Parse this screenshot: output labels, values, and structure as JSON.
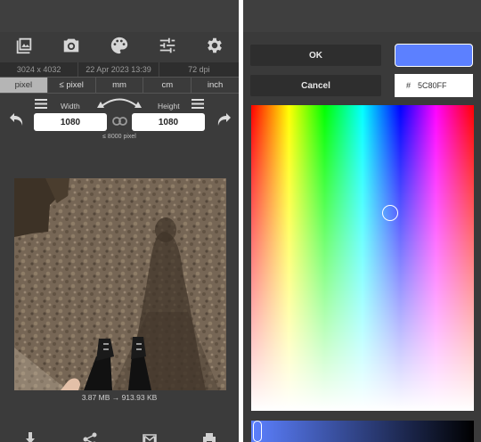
{
  "left": {
    "toolbar": {
      "icons": [
        "gallery-icon",
        "camera-icon",
        "palette-icon",
        "sliders-icon",
        "gear-icon"
      ]
    },
    "info": {
      "dimensions": "3024 x 4032",
      "date": "22 Apr 2023 13:39",
      "dpi": "72 dpi"
    },
    "units": {
      "items": [
        "pixel",
        "≤ pixel",
        "mm",
        "cm",
        "inch"
      ],
      "selected": "pixel"
    },
    "size": {
      "width_label": "Width",
      "height_label": "Height",
      "width_value": "1080",
      "height_value": "1080",
      "limit_note": "≤ 8000 pixel"
    },
    "file_size": "3.87 MB → 913.93 KB",
    "bottom_icons": [
      "download-icon",
      "share-icon",
      "mail-icon",
      "print-icon"
    ]
  },
  "right": {
    "ok_label": "OK",
    "cancel_label": "Cancel",
    "hash": "#",
    "hex_value": "5C80FF",
    "selected_color": "#5C80FF"
  }
}
